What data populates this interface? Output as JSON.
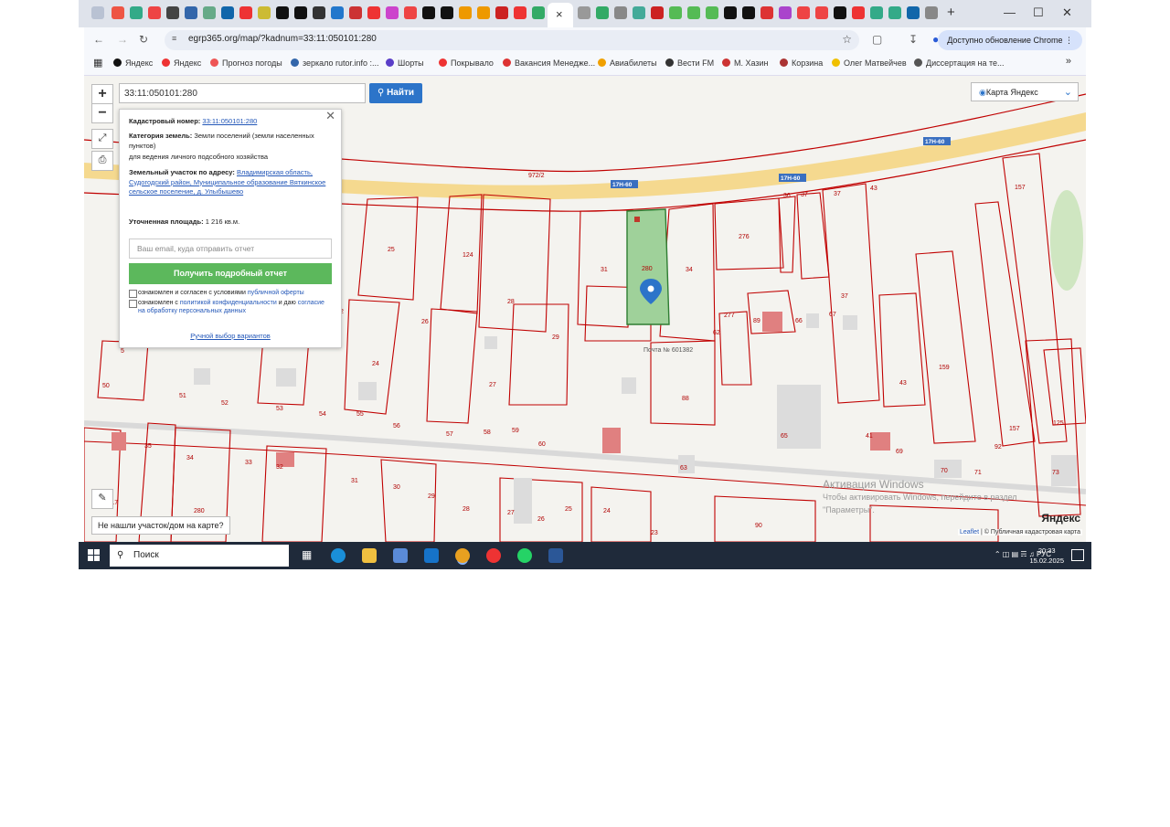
{
  "browser": {
    "url": "egrp365.org/map/?kadnum=33:11:050101:280",
    "update_label": "Доступно обновление Chrome",
    "new_tab": "+",
    "close_tab": "×"
  },
  "bookmarks": [
    {
      "label": "Яндекс",
      "color": "#111"
    },
    {
      "label": "Яндекс",
      "color": "#e33"
    },
    {
      "label": "Прогноз погоды",
      "color": "#e55"
    },
    {
      "label": "зеркало rutor.info :...",
      "color": "#36a"
    },
    {
      "label": "Шорты",
      "color": "#5a3ec8"
    },
    {
      "label": "Покрывало",
      "color": "#e33"
    },
    {
      "label": "Вакансия Менедже...",
      "color": "#d33"
    },
    {
      "label": "Авиабилеты",
      "color": "#f0a000"
    },
    {
      "label": "Вести FM",
      "color": "#333"
    },
    {
      "label": "М. Хазин",
      "color": "#c33"
    },
    {
      "label": "Корзина",
      "color": "#a33"
    },
    {
      "label": "Олег Матвейчев",
      "color": "#f0c000"
    },
    {
      "label": "Диссертация на те...",
      "color": "#555"
    }
  ],
  "map": {
    "search_value": "33:11:050101:280",
    "search_button": "Найти",
    "layer_select": "Карта Яндекс",
    "not_found": "Не нашли участок/дом на карте?",
    "watermark_title": "Активация Windows",
    "watermark_sub1": "Чтобы активировать Windows, перейдите в раздел",
    "watermark_sub2": "\"Параметры\".",
    "yandex": "Яндекс",
    "attribution_leaflet": "Leaflet",
    "attribution_rest": " | © Публичная кадастровая карта"
  },
  "popup": {
    "cad_label": "Кадастровый номер:",
    "cad_value": "33:11:050101:280",
    "category_label": "Категория земель:",
    "category_value": "Земли поселений (земли населенных пунктов)",
    "usage": "для ведения личного подсобного хозяйства",
    "address_label": "Земельный участок по адресу:",
    "address_value": "Владимирская область, Судогодский район, Муниципальное образование Вяткинское сельское поселение, д. Улыбышево",
    "area_label": "Уточненная площадь:",
    "area_value": "1 216 кв.м.",
    "email_placeholder": "Ваш email, куда отправить отчет",
    "report_button": "Получить подробный отчет",
    "agree1_text": "ознакомлен и согласен с условиями",
    "agree1_link": "публичной оферты",
    "agree2_text": "ознакомлен с",
    "agree2_link": "политикой конфиденциальности",
    "agree2_tail": "и даю",
    "agree2_link2": "согласие на обработку персональных данных",
    "manual": "Ручной выбор вариантов"
  },
  "map_labels": {
    "road": [
      "17Н-60",
      "17Н-60",
      "17Н-60"
    ],
    "road972": "972/2",
    "parcels": [
      "25",
      "124",
      "31",
      "280",
      "34",
      "276",
      "36",
      "37",
      "37",
      "43",
      "157",
      "26",
      "28",
      "29",
      "277",
      "89",
      "66",
      "67",
      "37",
      "2",
      "24",
      "27",
      "88",
      "159",
      "43",
      "50",
      "51",
      "52",
      "53",
      "54",
      "55",
      "56",
      "57",
      "58",
      "59",
      "60",
      "63",
      "65",
      "69",
      "70",
      "71",
      "92",
      "157",
      "125",
      "73",
      "35",
      "34",
      "33",
      "32",
      "31",
      "30",
      "29",
      "28",
      "27",
      "26",
      "25",
      "24",
      "23",
      "90",
      "280",
      "117",
      "5",
      "15",
      "41",
      "62"
    ],
    "post": "Почта № 601382"
  },
  "taskbar": {
    "search": "Поиск",
    "lang": "РУС",
    "time": "20:33",
    "date": "15.02.2025"
  },
  "colors": {
    "search_button": "#2c74c9",
    "report_button": "#5cb85c",
    "parcel_border": "#c00000",
    "selected_parcel": "#9fd19a",
    "road": "#f5d98f"
  }
}
